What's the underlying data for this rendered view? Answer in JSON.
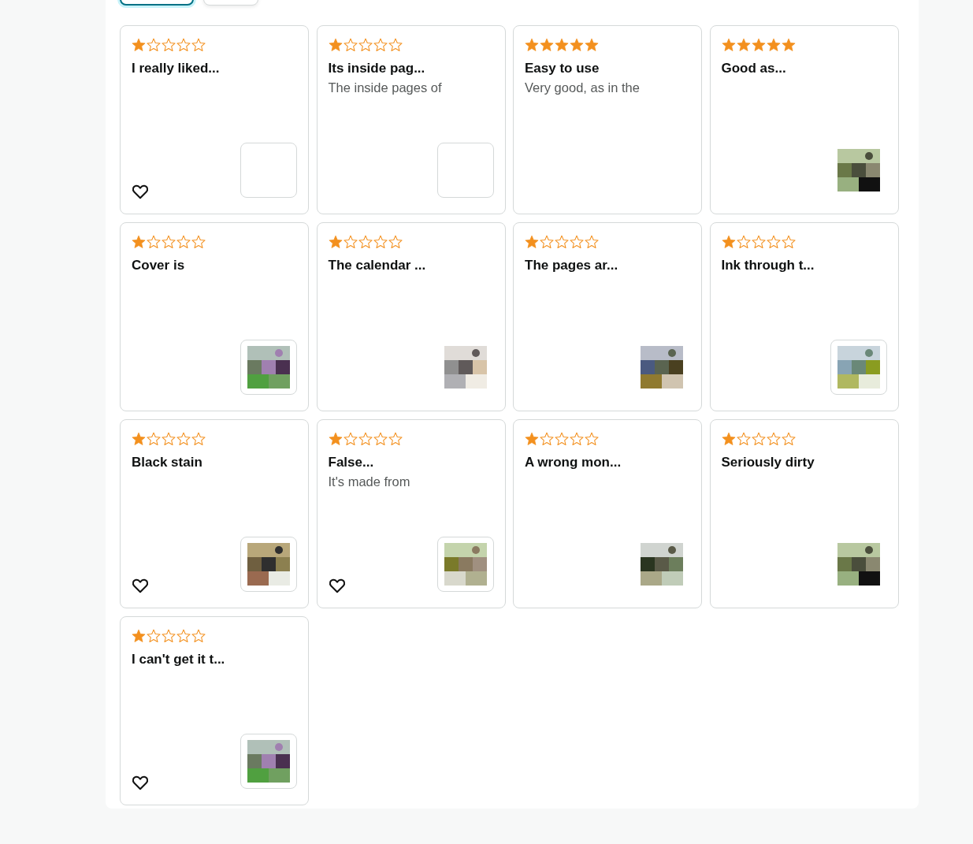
{
  "filter_buttons": [
    {
      "selected": true
    },
    {
      "selected": false
    }
  ],
  "reviews": [
    {
      "stars": 1,
      "title": "I really liked...",
      "heart": true,
      "photo": false,
      "frame": true
    },
    {
      "stars": 1,
      "title": "Its inside pag...",
      "body": "The inside pages of",
      "heart": false,
      "photo": false,
      "frame": true
    },
    {
      "stars": 5,
      "title": "Easy to use",
      "body": "Very good, as in the",
      "heart": false,
      "photo": false,
      "frame": false
    },
    {
      "stars": 5,
      "title": "Good as...",
      "heart": false,
      "photo": true,
      "frame": false
    },
    {
      "stars": 1,
      "title": "Cover is",
      "heart": false,
      "photo": true,
      "frame": true
    },
    {
      "stars": 1,
      "title": "The calendar ...",
      "heart": false,
      "photo": true,
      "frame": false
    },
    {
      "stars": 1,
      "title": "The pages ar...",
      "heart": false,
      "photo": true,
      "frame": false
    },
    {
      "stars": 1,
      "title": "Ink through t...",
      "heart": false,
      "photo": true,
      "frame": true
    },
    {
      "stars": 1,
      "title": "Black stain",
      "heart": true,
      "photo": true,
      "frame": true
    },
    {
      "stars": 1,
      "title": "False...",
      "body": "It's made from",
      "heart": true,
      "photo": true,
      "frame": true
    },
    {
      "stars": 1,
      "title": "A wrong mon...",
      "heart": false,
      "photo": true,
      "frame": false
    },
    {
      "stars": 1,
      "title": "Seriously dirty",
      "heart": false,
      "photo": true,
      "frame": false
    },
    {
      "stars": 1,
      "title": "I can't get it t...",
      "heart": true,
      "photo": true,
      "frame": true
    }
  ]
}
